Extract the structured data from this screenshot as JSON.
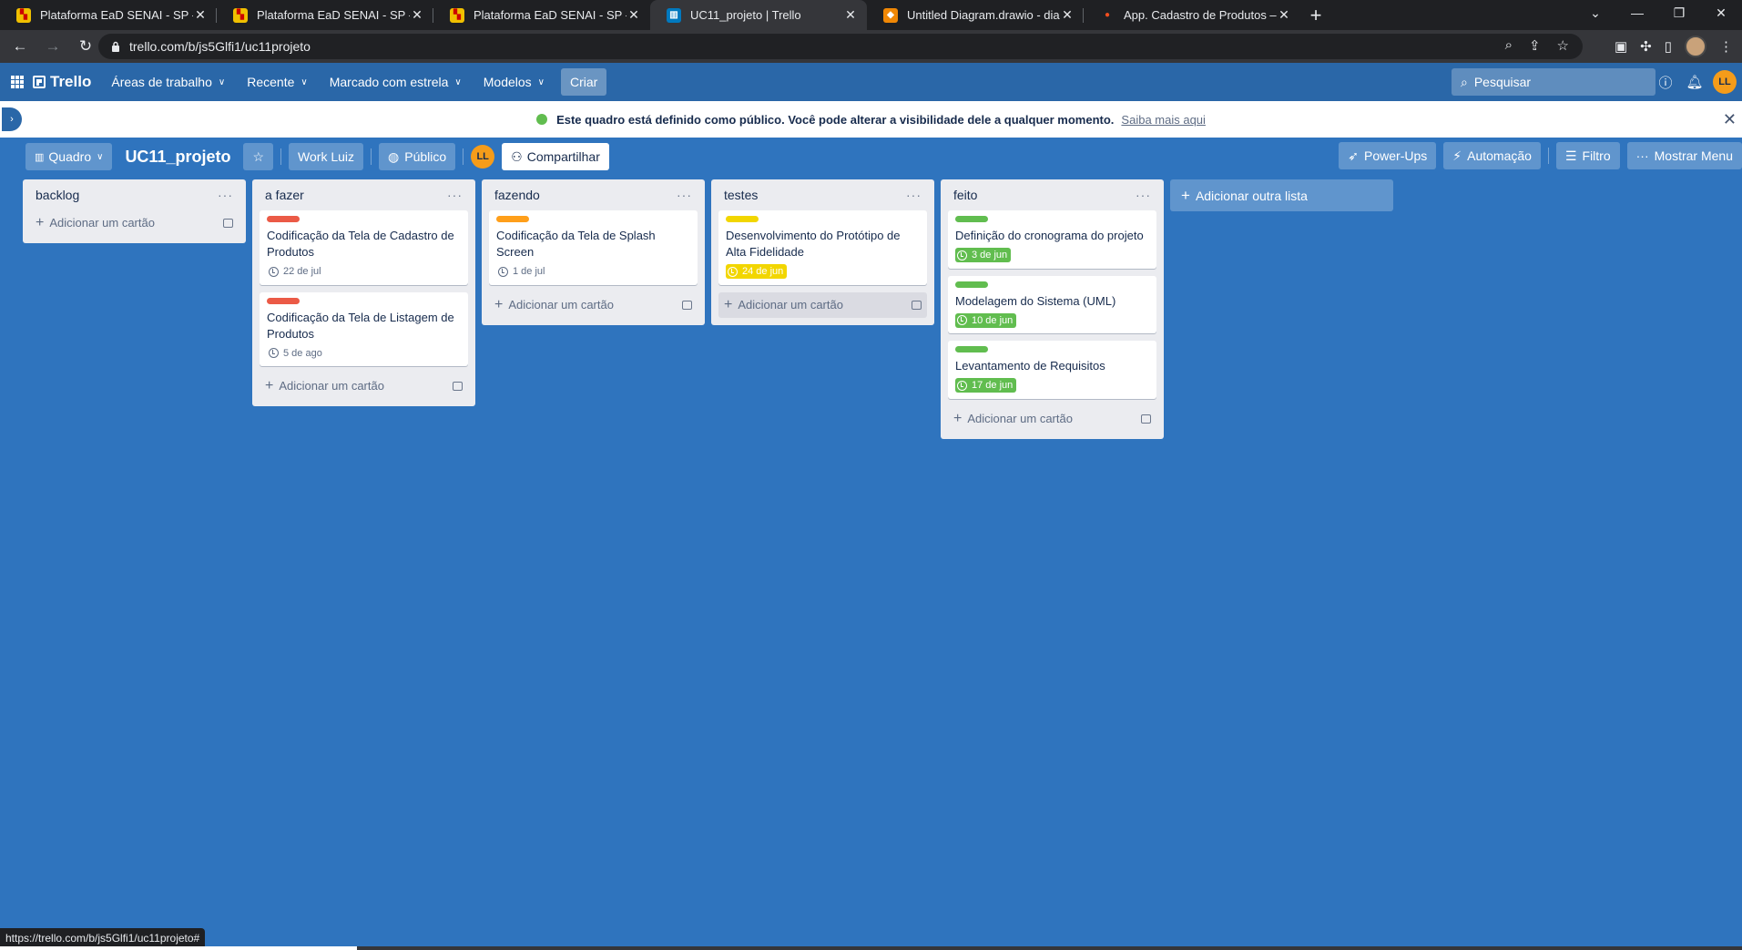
{
  "browser": {
    "tabs": [
      {
        "title": "Plataforma EaD SENAI - SP - QDI",
        "favicon": "senai",
        "active": false
      },
      {
        "title": "Plataforma EaD SENAI - SP - QDI",
        "favicon": "senai",
        "active": false
      },
      {
        "title": "Plataforma EaD SENAI - SP - QDI",
        "favicon": "senai",
        "active": false
      },
      {
        "title": "UC11_projeto | Trello",
        "favicon": "trello",
        "active": true
      },
      {
        "title": "Untitled Diagram.drawio - diagrams.net",
        "favicon": "drawio",
        "active": false
      },
      {
        "title": "App. Cadastro de Produtos – Figma",
        "favicon": "figma",
        "active": false
      }
    ],
    "url": "trello.com/b/js5Glfi1/uc11projeto",
    "status_url": "https://trello.com/b/js5Glfi1/uc11projeto#"
  },
  "header": {
    "brand": "Trello",
    "menu": [
      "Áreas de trabalho",
      "Recente",
      "Marcado com estrela",
      "Modelos"
    ],
    "create_label": "Criar",
    "search_placeholder": "Pesquisar",
    "avatar_initials": "LL"
  },
  "notice": {
    "text": "Este quadro está definido como público. Você pode alterar a visibilidade dele a qualquer momento.",
    "link": "Saiba mais aqui"
  },
  "board": {
    "view_label": "Quadro",
    "title": "UC11_projeto",
    "workspace": "Work Luiz",
    "visibility": "Público",
    "member_initials": "LL",
    "share_label": "Compartilhar",
    "powerups_label": "Power-Ups",
    "automation_label": "Automação",
    "filter_label": "Filtro",
    "menu_label": "Mostrar Menu",
    "add_list_label": "Adicionar outra lista",
    "add_card_label": "Adicionar um cartão",
    "lists": [
      {
        "title": "backlog",
        "cards": []
      },
      {
        "title": "a fazer",
        "cards": [
          {
            "title": "Codificação da Tela de Cadastro de Produtos",
            "label_color": "#eb5a46",
            "due": "22 de jul",
            "due_style": "plain"
          },
          {
            "title": "Codificação da Tela de Listagem de Produtos",
            "label_color": "#eb5a46",
            "due": "5 de ago",
            "due_style": "plain"
          }
        ]
      },
      {
        "title": "fazendo",
        "cards": [
          {
            "title": "Codificação da Tela de Splash Screen",
            "label_color": "#ff9f1a",
            "due": "1 de jul",
            "due_style": "plain"
          }
        ]
      },
      {
        "title": "testes",
        "cards": [
          {
            "title": "Desenvolvimento do Protótipo de Alta Fidelidade",
            "label_color": "#f2d600",
            "due": "24 de jun",
            "due_style": "yellow"
          }
        ]
      },
      {
        "title": "feito",
        "cards": [
          {
            "title": "Definição do cronograma do projeto",
            "label_color": "#61bd4f",
            "due": "3 de jun",
            "due_style": "green"
          },
          {
            "title": "Modelagem do Sistema (UML)",
            "label_color": "#61bd4f",
            "due": "10 de jun",
            "due_style": "green"
          },
          {
            "title": "Levantamento de Requisitos",
            "label_color": "#61bd4f",
            "due": "17 de jun",
            "due_style": "green"
          }
        ]
      }
    ]
  }
}
